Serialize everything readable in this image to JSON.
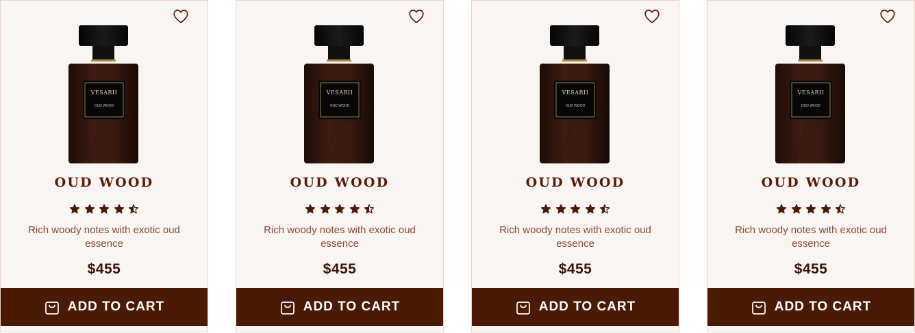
{
  "colors": {
    "brand_dark": "#4b1a05",
    "title": "#5a1c08",
    "card_bg": "#f8f5f3",
    "text_muted": "#8b4a32"
  },
  "products": [
    {
      "brand": "VESARII",
      "label_name": "OUD WOOD",
      "title": "OUD WOOD",
      "rating": 4.5,
      "description": "Rich woody notes with exotic oud essence",
      "price": "$455",
      "cart_label": "ADD TO CART",
      "wishlist_icon": "heart-icon",
      "cart_icon": "shopping-bag-icon"
    },
    {
      "brand": "VESARII",
      "label_name": "OUD WOOD",
      "title": "OUD WOOD",
      "rating": 4.5,
      "description": "Rich woody notes with exotic oud essence",
      "price": "$455",
      "cart_label": "ADD TO CART",
      "wishlist_icon": "heart-icon",
      "cart_icon": "shopping-bag-icon"
    },
    {
      "brand": "VESARII",
      "label_name": "OUD WOOD",
      "title": "OUD WOOD",
      "rating": 4.5,
      "description": "Rich woody notes with exotic oud essence",
      "price": "$455",
      "cart_label": "ADD TO CART",
      "wishlist_icon": "heart-icon",
      "cart_icon": "shopping-bag-icon"
    },
    {
      "brand": "VESARII",
      "label_name": "OUD WOOD",
      "title": "OUD WOOD",
      "rating": 4.5,
      "description": "Rich woody notes with exotic oud essence",
      "price": "$455",
      "cart_label": "ADD TO CART",
      "wishlist_icon": "heart-icon",
      "cart_icon": "shopping-bag-icon"
    }
  ]
}
